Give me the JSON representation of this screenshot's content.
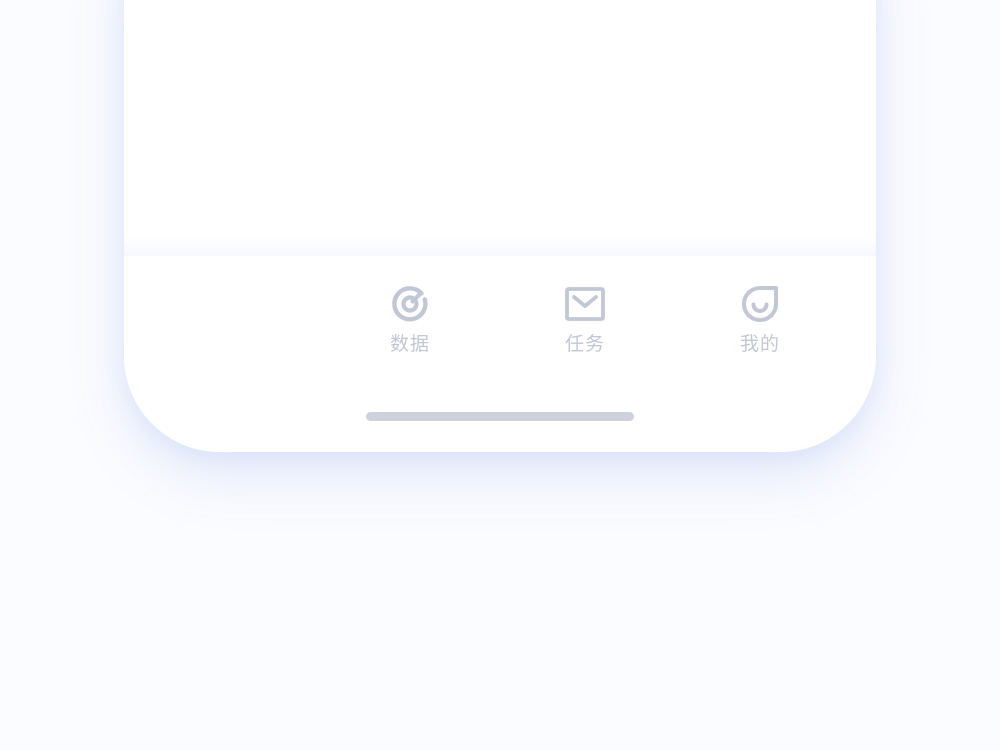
{
  "colors": {
    "background": "#fbfcff",
    "tab_icon": "#c2c7d6",
    "tab_label": "#c2c7d6",
    "home_indicator": "#cdd1de"
  },
  "tabbar": {
    "tabs": [
      {
        "label": "数据",
        "icon": "gauge-icon",
        "active": false
      },
      {
        "label": "任务",
        "icon": "mail-icon",
        "active": false
      },
      {
        "label": "我的",
        "icon": "smile-icon",
        "active": false
      }
    ]
  }
}
